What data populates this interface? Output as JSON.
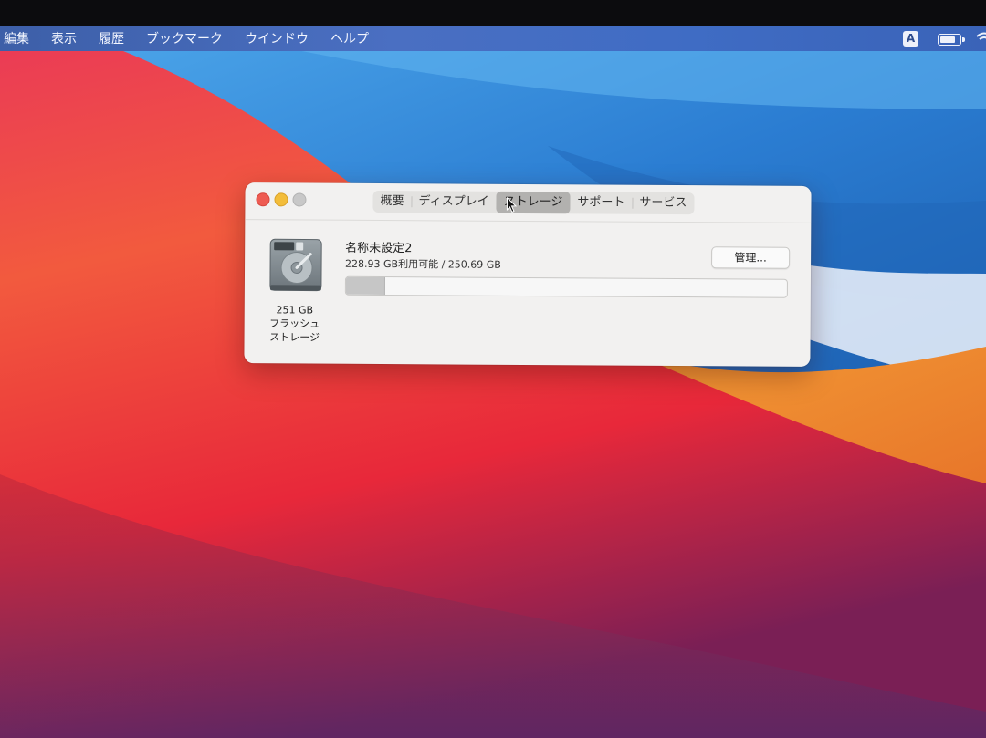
{
  "menubar": {
    "items": [
      {
        "label": "編集"
      },
      {
        "label": "表示"
      },
      {
        "label": "履歴"
      },
      {
        "label": "ブックマーク"
      },
      {
        "label": "ウインドウ"
      },
      {
        "label": "ヘルプ"
      }
    ],
    "input_source": "A"
  },
  "window": {
    "tabs": [
      {
        "label": "概要"
      },
      {
        "label": "ディスプレイ"
      },
      {
        "label": "ストレージ"
      },
      {
        "label": "サポート"
      },
      {
        "label": "サービス"
      }
    ],
    "active_tab": "ストレージ",
    "drive": {
      "capacity": "251 GB",
      "type_line1": "フラッシュ",
      "type_line2": "ストレージ",
      "icon": "hard-drive-icon"
    },
    "volume": {
      "name": "名称未設定2",
      "availability": "228.93 GB利用可能 / 250.69 GB",
      "used_fraction": 0.087
    },
    "manage_button": "管理..."
  },
  "colors": {
    "close": "#ee5b52",
    "minimize": "#f3bd3a",
    "zoom": "#c8c8c8",
    "wallpaper_red": "#e8383a",
    "wallpaper_blue": "#2f7fd0",
    "wallpaper_orange": "#f08a2c"
  }
}
